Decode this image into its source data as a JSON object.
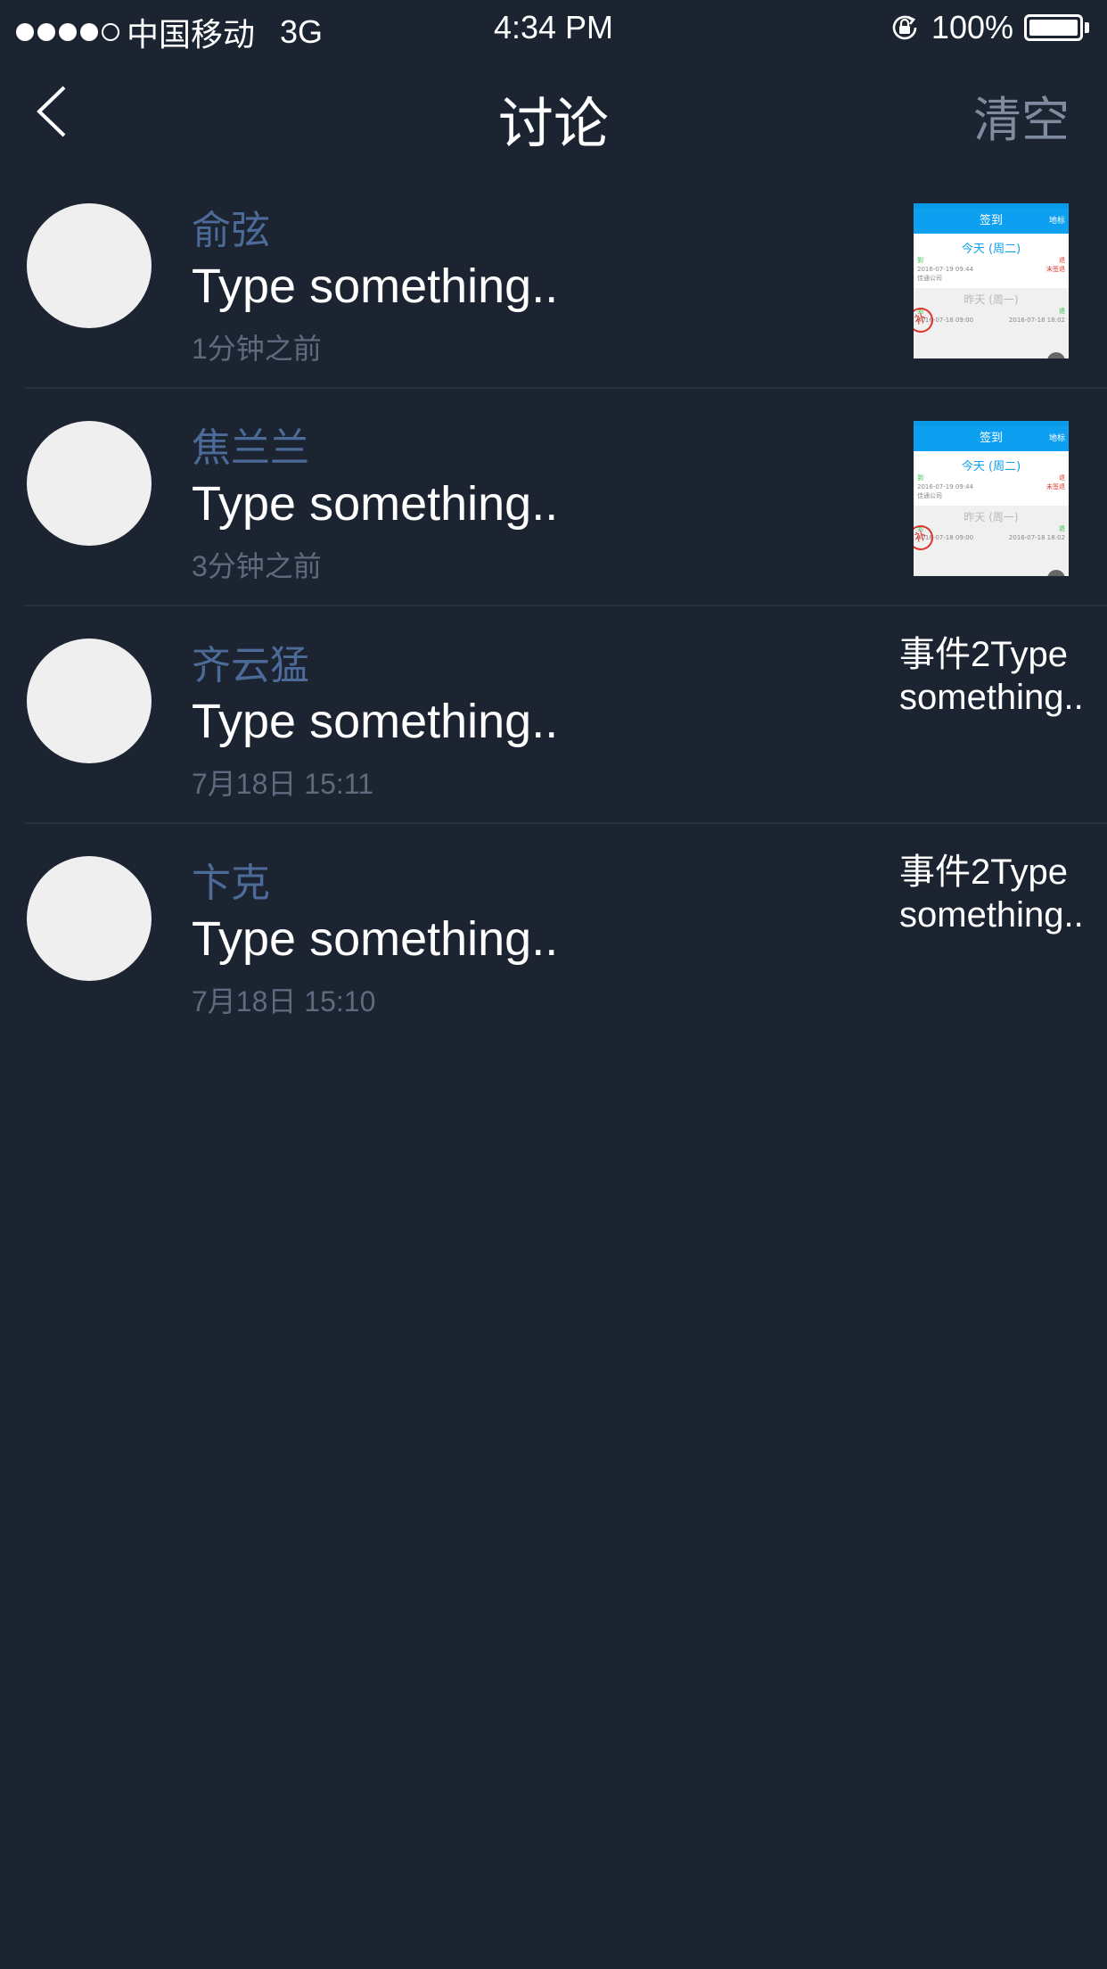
{
  "status_bar": {
    "carrier": "中国移动",
    "network": "3G",
    "time": "4:34 PM",
    "battery": "100%",
    "battery_level": 1.0,
    "signal_strength": 4,
    "signal_max": 5
  },
  "nav": {
    "back_icon": "chevron-left-icon",
    "title": "讨论",
    "clear_label": "清空"
  },
  "thumbnail": {
    "header_title": "签到",
    "header_right": "地标",
    "today_label": "今天 (周二)",
    "checkin_label": "到",
    "checkout_label": "退",
    "today_checkin_time": "2016-07-19 09:44",
    "today_checkout_status": "未签退",
    "company": "佳通公司",
    "yesterday_label": "昨天 (周一)",
    "yesterday_checkin_time": "2016-07-18 09:00",
    "yesterday_checkout_time": "2016-07-18 18:02",
    "stamp": "补"
  },
  "messages": [
    {
      "sender": "俞弦",
      "text": "Type something..",
      "time": "1分钟之前",
      "context_type": "thumbnail"
    },
    {
      "sender": "焦兰兰",
      "text": "Type something..",
      "time": "3分钟之前",
      "context_type": "thumbnail"
    },
    {
      "sender": "齐云猛",
      "text": "Type something..",
      "time": "7月18日  15:11",
      "context_type": "text",
      "context_line1": "事件2Type",
      "context_line2": "something.."
    },
    {
      "sender": "卞克",
      "text": "Type something..",
      "time": "7月18日  15:10",
      "context_type": "text",
      "context_line1": "事件2Type",
      "context_line2": "something.."
    }
  ]
}
